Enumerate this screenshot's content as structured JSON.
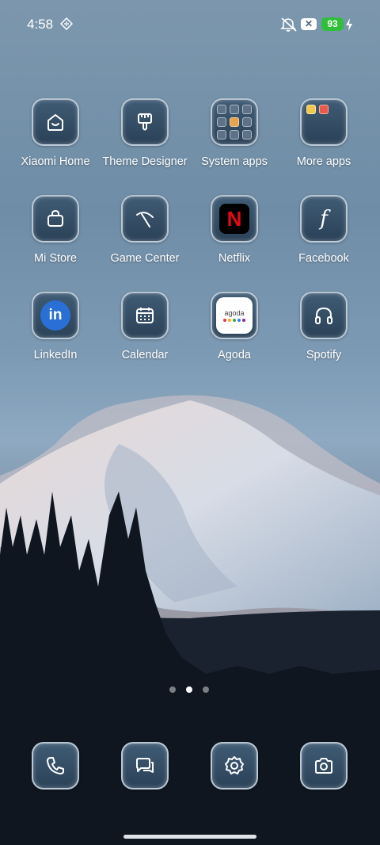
{
  "status_bar": {
    "time": "4:58",
    "battery_percent": "93",
    "battery_color": "#2fbf3a",
    "icons": [
      "sync-icon",
      "mute-icon",
      "x-icon",
      "battery-icon",
      "charging-bolt-icon"
    ]
  },
  "apps": [
    {
      "label": "Xiaomi Home",
      "icon": "home-icon"
    },
    {
      "label": "Theme Designer",
      "icon": "paintbrush-icon"
    },
    {
      "label": "System apps",
      "icon": "folder-icon"
    },
    {
      "label": "More apps",
      "icon": "folder-icon"
    },
    {
      "label": "Mi Store",
      "icon": "shopping-bag-icon"
    },
    {
      "label": "Game Center",
      "icon": "game-center-icon"
    },
    {
      "label": "Netflix",
      "icon": "netflix-icon"
    },
    {
      "label": "Facebook",
      "icon": "facebook-icon"
    },
    {
      "label": "LinkedIn",
      "icon": "linkedin-icon"
    },
    {
      "label": "Calendar",
      "icon": "calendar-icon"
    },
    {
      "label": "Agoda",
      "icon": "agoda-icon"
    },
    {
      "label": "Spotify",
      "icon": "headphones-icon"
    }
  ],
  "linkedin_text": "in",
  "netflix_text": "N",
  "facebook_text": "f",
  "agoda_text": "agoda",
  "x_text": "✕",
  "dock": [
    {
      "icon": "phone-icon"
    },
    {
      "icon": "messages-icon"
    },
    {
      "icon": "settings-icon"
    },
    {
      "icon": "camera-icon"
    }
  ],
  "page_indicator": {
    "count": 3,
    "active": 2
  }
}
